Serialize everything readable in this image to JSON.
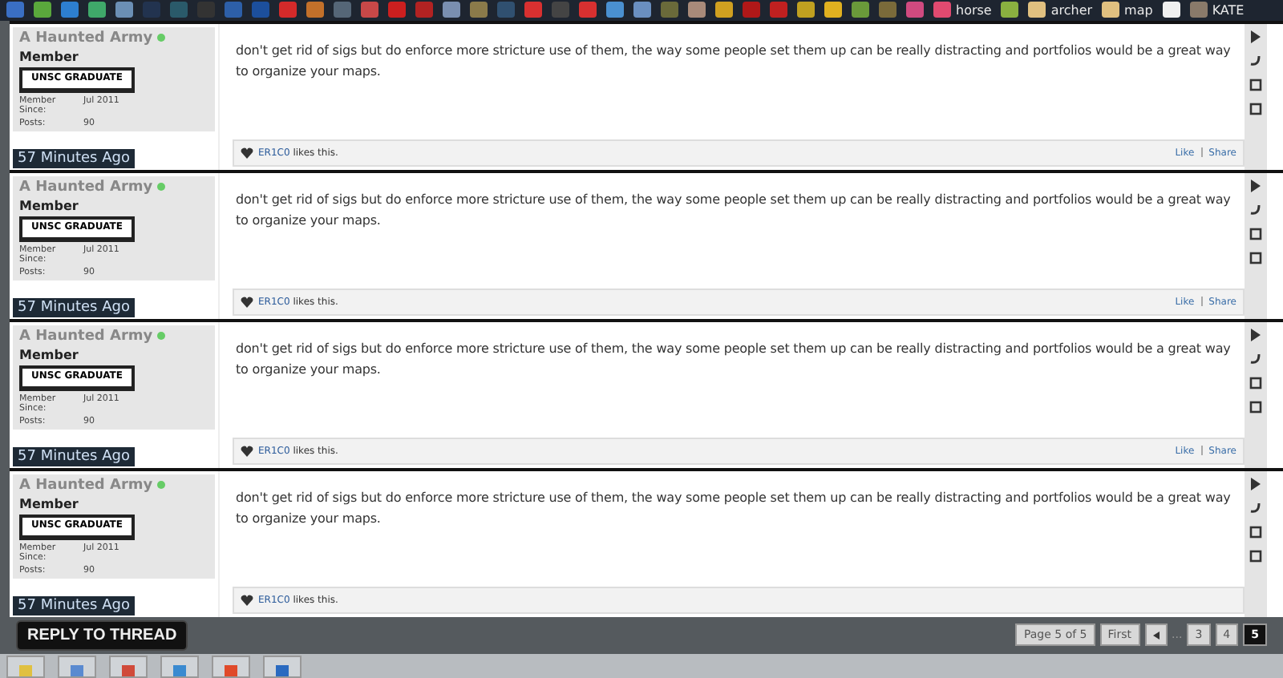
{
  "bookmarks": [
    {
      "color": "#3a6fc4"
    },
    {
      "color": "#5aa83c"
    },
    {
      "color": "#2d7fd0"
    },
    {
      "color": "#3fa86a"
    },
    {
      "color": "#6b8fb5"
    },
    {
      "color": "#22334f"
    },
    {
      "color": "#2a5a6a"
    },
    {
      "color": "#333333"
    },
    {
      "color": "#2d5fa8"
    },
    {
      "color": "#1c4f9c"
    },
    {
      "color": "#d42a2a"
    },
    {
      "color": "#c2702a"
    },
    {
      "color": "#556677"
    },
    {
      "color": "#c84848"
    },
    {
      "color": "#cc1f1f"
    },
    {
      "color": "#b22222"
    },
    {
      "color": "#7a8fb0"
    },
    {
      "color": "#8a7a4a"
    },
    {
      "color": "#305070"
    },
    {
      "color": "#d83030"
    },
    {
      "color": "#444444"
    },
    {
      "color": "#d83030"
    },
    {
      "color": "#4a90d0"
    },
    {
      "color": "#6a8fc0"
    },
    {
      "color": "#6a6a3a"
    },
    {
      "color": "#a88a7a"
    },
    {
      "color": "#d0a020"
    },
    {
      "color": "#b01818"
    },
    {
      "color": "#c02020"
    },
    {
      "color": "#c0a020"
    },
    {
      "color": "#e0b020"
    },
    {
      "color": "#6a9a3a"
    },
    {
      "color": "#7a6a3a"
    },
    {
      "color": "#d04a80"
    },
    {
      "color": "#e04a70",
      "label": "horse"
    },
    {
      "color": "#8ab040"
    },
    {
      "color": "#e0c080",
      "label": "archer"
    },
    {
      "color": "#e0c080",
      "label": "map"
    },
    {
      "color": "#f0f0f0"
    },
    {
      "color": "#8a7a6a",
      "label": "KATE"
    }
  ],
  "posts": [
    {
      "username": "A Haunted Army",
      "online": true,
      "rank": "Member",
      "badge": "UNSC GRADUATE",
      "since_label": "Member Since:",
      "since": "Jul 2011",
      "posts_label": "Posts:",
      "posts": "90",
      "time": "57 Minutes Ago",
      "body": "don't get rid of sigs but do enforce more stricture use of them, the way some people set them up can be really distracting and portfolios would be a great way to organize your maps.",
      "liker": "ER1C0",
      "likes_text": "likes this.",
      "actions": [
        "Like",
        "Share"
      ]
    },
    {
      "username": "A Haunted Army",
      "online": true,
      "rank": "Member",
      "badge": "UNSC GRADUATE",
      "since_label": "Member Since:",
      "since": "Jul 2011",
      "posts_label": "Posts:",
      "posts": "90",
      "time": "57 Minutes Ago",
      "body": "don't get rid of sigs but do enforce more stricture use of them, the way some people set them up can be really distracting and portfolios would be a great way to organize your maps.",
      "liker": "ER1C0",
      "likes_text": "likes this.",
      "actions": [
        "Like",
        "Share"
      ]
    },
    {
      "username": "A Haunted Army",
      "online": true,
      "rank": "Member",
      "badge": "UNSC GRADUATE",
      "since_label": "Member Since:",
      "since": "Jul 2011",
      "posts_label": "Posts:",
      "posts": "90",
      "time": "57 Minutes Ago",
      "body": "don't get rid of sigs but do enforce more stricture use of them, the way some people set them up can be really distracting and portfolios would be a great way to organize your maps.",
      "liker": "ER1C0",
      "likes_text": "likes this.",
      "actions": [
        "Like",
        "Share"
      ]
    },
    {
      "username": "A Haunted Army",
      "online": true,
      "rank": "Member",
      "badge": "UNSC GRADUATE",
      "since_label": "Member Since:",
      "since": "Jul 2011",
      "posts_label": "Posts:",
      "posts": "90",
      "time": "57 Minutes Ago",
      "body": "don't get rid of sigs but do enforce more stricture use of them, the way some people set them up can be really distracting and portfolios would be a great way to organize your maps.",
      "liker": "ER1C0",
      "likes_text": "likes this."
    }
  ],
  "reply_button": "REPLY TO THREAD",
  "pagination": {
    "page_label": "Page 5 of 5",
    "first": "First",
    "ellipsis": "...",
    "pages": [
      {
        "label": "3",
        "selected": false
      },
      {
        "label": "4",
        "selected": false
      },
      {
        "label": "5",
        "selected": true
      }
    ]
  },
  "taskbar": [
    {
      "color": "#e0c040"
    },
    {
      "color": "#5a8ad0"
    },
    {
      "color": "#d04a3a"
    },
    {
      "color": "#3a8ad0"
    },
    {
      "color": "#e04a2a"
    },
    {
      "color": "#2a6ac0"
    }
  ]
}
